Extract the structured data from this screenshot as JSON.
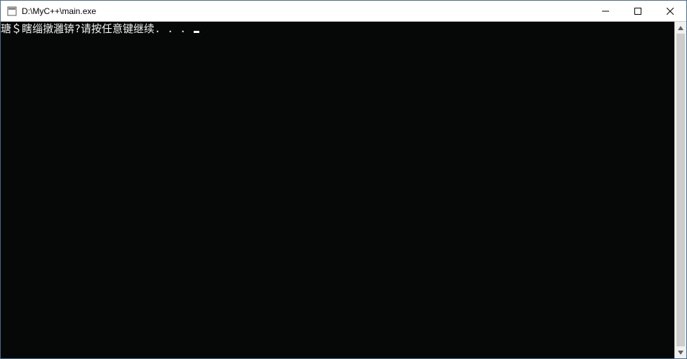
{
  "window": {
    "title": "D:\\MyC++\\main.exe"
  },
  "console": {
    "output": "瑭＄瞎缁撴灉锛?请按任意键继续. . . "
  }
}
